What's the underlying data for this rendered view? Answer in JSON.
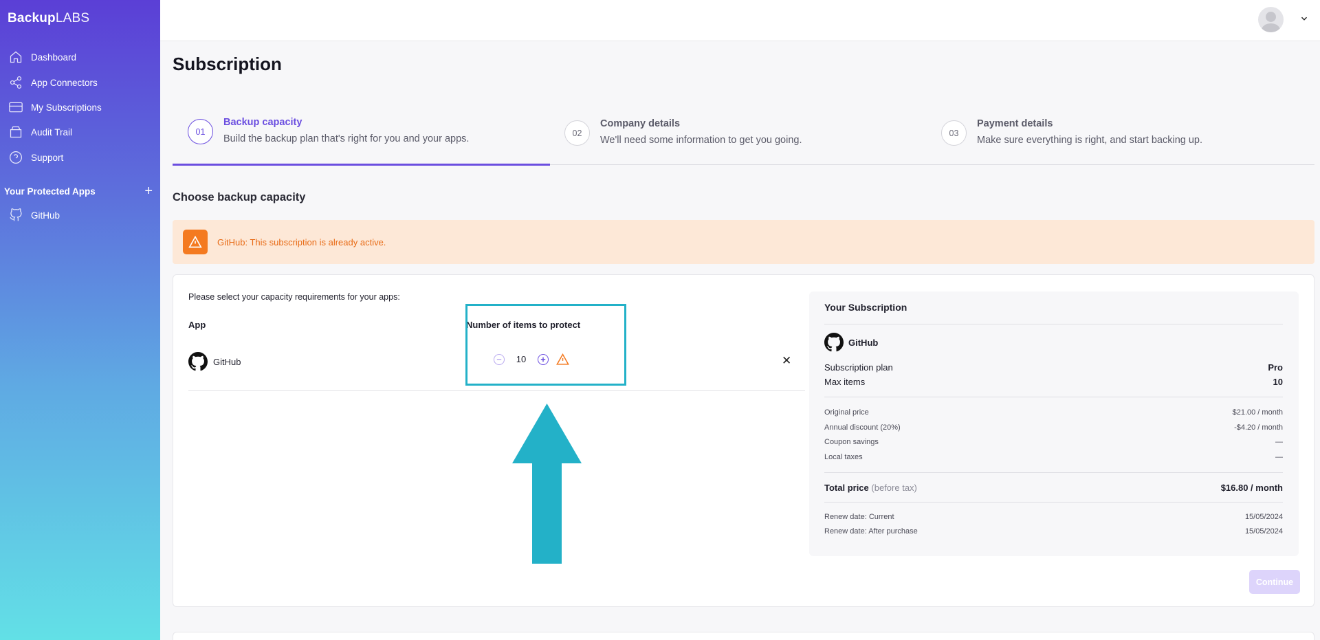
{
  "brand": {
    "bold": "Backup",
    "light": "LABS"
  },
  "sidebar": {
    "items": [
      {
        "label": "Dashboard",
        "icon": "home-icon"
      },
      {
        "label": "App Connectors",
        "icon": "share-icon"
      },
      {
        "label": "My Subscriptions",
        "icon": "credit-card-icon"
      },
      {
        "label": "Audit Trail",
        "icon": "archive-icon"
      },
      {
        "label": "Support",
        "icon": "help-circle-icon"
      }
    ],
    "protected_title": "Your Protected Apps",
    "protected_apps": [
      {
        "label": "GitHub",
        "icon": "github-icon"
      }
    ]
  },
  "page": {
    "title": "Subscription"
  },
  "steps": [
    {
      "num": "01",
      "title": "Backup capacity",
      "desc": "Build the backup plan that's right for you and your apps."
    },
    {
      "num": "02",
      "title": "Company details",
      "desc": "We'll need some information to get you going."
    },
    {
      "num": "03",
      "title": "Payment details",
      "desc": "Make sure everything is right, and start backing up."
    }
  ],
  "section_title": "Choose backup capacity",
  "alert": {
    "text": "GitHub: This subscription is already active."
  },
  "capacity": {
    "intro": "Please select your capacity requirements for your apps:",
    "col_app": "App",
    "col_items": "Number of items to protect",
    "rows": [
      {
        "app": "GitHub",
        "items": "10"
      }
    ]
  },
  "summary": {
    "title": "Your Subscription",
    "app": "GitHub",
    "plan_label": "Subscription plan",
    "plan_value": "Pro",
    "max_label": "Max items",
    "max_value": "10",
    "original_label": "Original price",
    "original_value": "$21.00 / month",
    "discount_label": "Annual discount (20%)",
    "discount_value": "-$4.20 / month",
    "coupon_label": "Coupon savings",
    "coupon_value": "—",
    "taxes_label": "Local taxes",
    "taxes_value": "—",
    "total_label": "Total price",
    "total_note": "(before tax)",
    "total_value": "$16.80 / month",
    "renew_current_label": "Renew date: Current",
    "renew_current_value": "15/05/2024",
    "renew_after_label": "Renew date: After purchase",
    "renew_after_value": "15/05/2024"
  },
  "continue_label": "Continue",
  "colors": {
    "accent": "#6b4ee0",
    "warning": "#f47a20",
    "highlight": "#23b1c8"
  }
}
